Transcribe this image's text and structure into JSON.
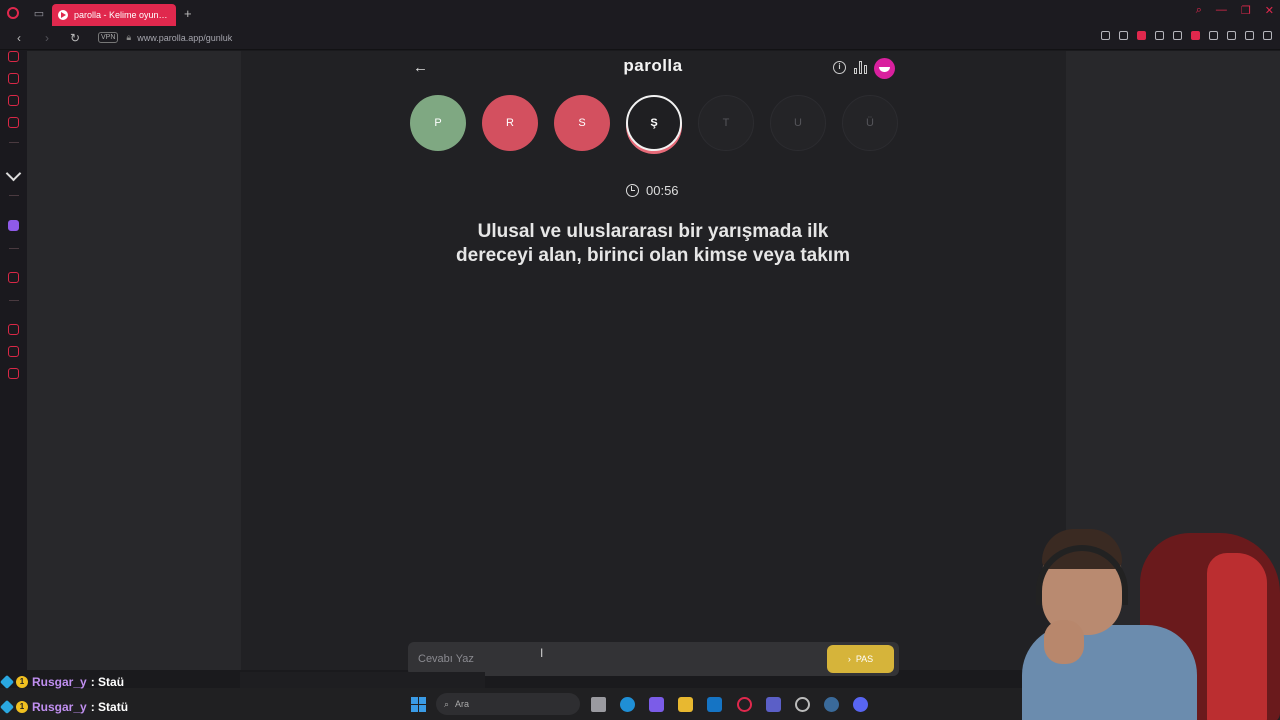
{
  "browser": {
    "tab_title": "parolla - Kelime oyunu, Gü",
    "url": "www.parolla.app/gunluk",
    "vpn_label": "VPN"
  },
  "app": {
    "title": "parolla",
    "back_icon": "arrow-left-icon",
    "info_icon": "info-icon",
    "stats_icon": "bar-chart-icon",
    "accent": "#e0284d"
  },
  "letters": [
    {
      "letter": "P",
      "status": "correct"
    },
    {
      "letter": "R",
      "status": "wrong"
    },
    {
      "letter": "S",
      "status": "wrong"
    },
    {
      "letter": "Ş",
      "status": "current"
    },
    {
      "letter": "T",
      "status": "pending"
    },
    {
      "letter": "U",
      "status": "pending"
    },
    {
      "letter": "Ü",
      "status": "pending"
    }
  ],
  "status_colors": {
    "correct": "#7fa882",
    "wrong": "#d3505f",
    "pass": "#d6b43a"
  },
  "timer": "00:56",
  "question": "Ulusal ve uluslararası bir yarışmada ilk dereceyi alan, birinci olan kimse veya takım",
  "answer": {
    "placeholder": "Cevabı Yaz",
    "value": "",
    "pass_label": "PAS"
  },
  "taskbar": {
    "search_label": "Ara"
  },
  "chat": [
    {
      "user": "Rusgar_y",
      "message": ": Staü"
    },
    {
      "user": "Rusgar_y",
      "message": ": Statü"
    }
  ]
}
